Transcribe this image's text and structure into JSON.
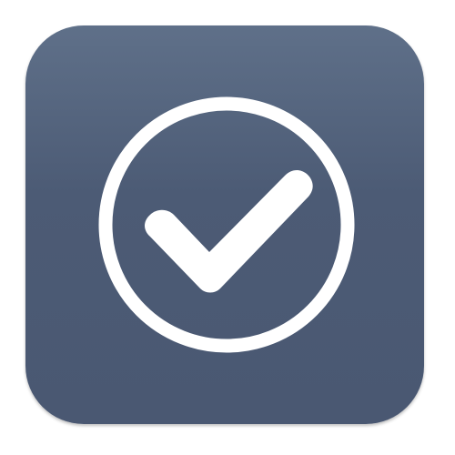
{
  "app_icon": {
    "icon": "checkmark-circle-icon",
    "colors": {
      "background_top": "#5f7089",
      "background_mid": "#4c5b75",
      "background_bottom": "#4a5872",
      "glyph": "#ffffff"
    }
  }
}
